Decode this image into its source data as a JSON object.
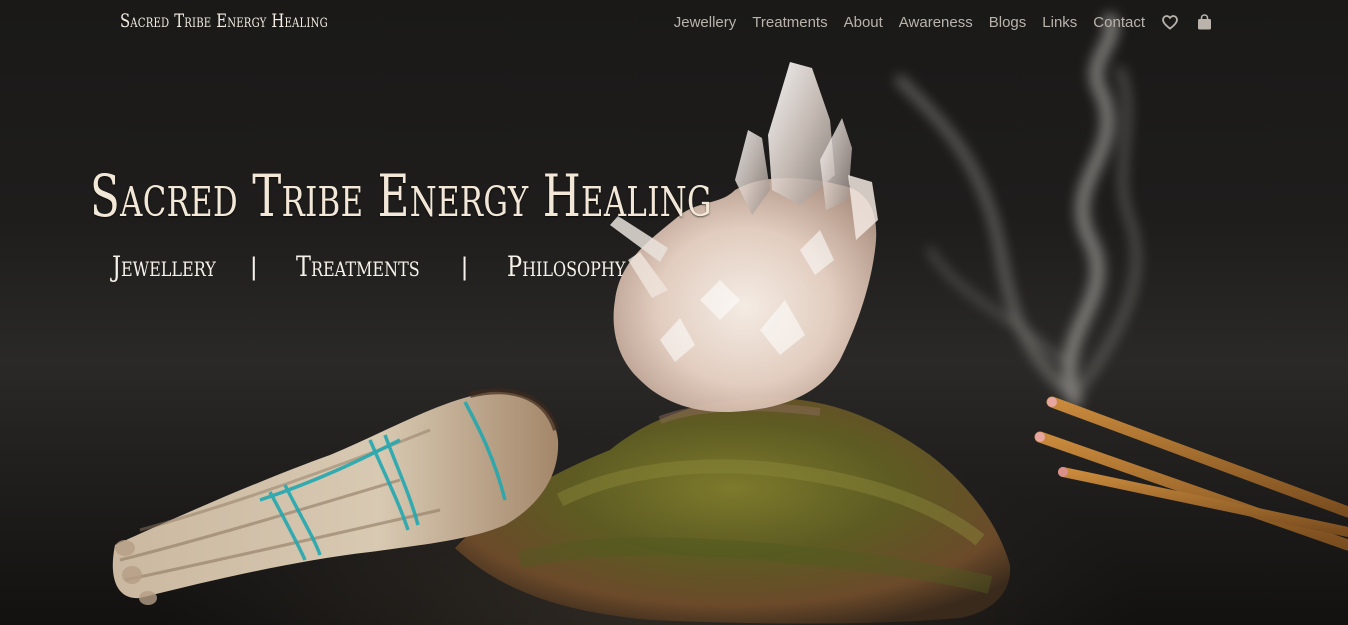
{
  "brand": {
    "name": "Sacred Tribe Energy Healing"
  },
  "nav": {
    "items": [
      {
        "label": "Jewellery"
      },
      {
        "label": "Treatments"
      },
      {
        "label": "About"
      },
      {
        "label": "Awareness"
      },
      {
        "label": "Blogs"
      },
      {
        "label": "Links"
      },
      {
        "label": "Contact"
      }
    ],
    "icons": [
      "heart-icon",
      "shopping-bag-icon"
    ]
  },
  "hero": {
    "title": "Sacred Tribe Energy Healing",
    "links": [
      {
        "label": "Jewellery"
      },
      {
        "label": "Treatments"
      },
      {
        "label": "Philosophy"
      }
    ],
    "separator": "|"
  },
  "colors": {
    "background": "#161514",
    "nav_text": "#b9b3ab",
    "hero_text": "#f3e8d8"
  }
}
